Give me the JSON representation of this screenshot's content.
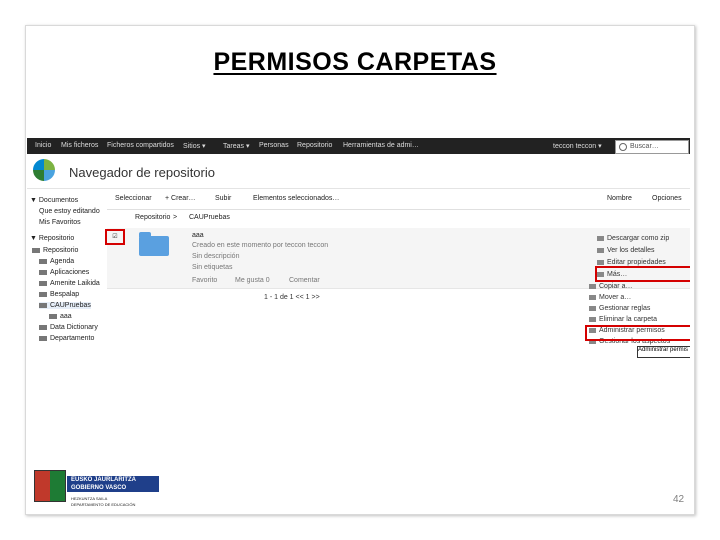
{
  "slide": {
    "title": "PERMISOS CARPETAS",
    "page_number": "42"
  },
  "topnav": {
    "items": [
      "Inicio",
      "Mis ficheros",
      "Ficheros compartidos",
      "Sitios ▾",
      "Tareas ▾",
      "Personas",
      "Repositorio",
      "Herramientas de admi…"
    ],
    "user": "teccon teccon ▾",
    "search_placeholder": "Buscar…"
  },
  "header": {
    "title": "Navegador de repositorio"
  },
  "sidebar": {
    "documents_header": "▼ Documentos",
    "doc_items": [
      "Que estoy editando",
      "Mis Favoritos"
    ],
    "repo_header": "▼ Repositorio",
    "repo_root": "Repositorio",
    "folders": [
      "Agenda",
      "Aplicaciones",
      "Amenite Laikida",
      "Bespalap",
      "CAUPruebas",
      "aaa",
      "Data Dictionary",
      "Departamento"
    ]
  },
  "toolbar": {
    "select": "Seleccionar",
    "create": "+ Crear…",
    "upload": "Subir",
    "selected": "Elementos seleccionados…",
    "name": "Nombre",
    "options": "Opciones"
  },
  "breadcrumb": {
    "root": "Repositorio",
    "sep": ">",
    "current": "CAUPruebas"
  },
  "folder_row": {
    "name": "aaa",
    "created": "Creado en este momento por teccon teccon",
    "no_description": "Sin descripción",
    "no_tags": "Sin etiquetas",
    "favorite": "Favorito",
    "like": "Me gusta  0",
    "comment": "Comentar"
  },
  "paging": "1 - 1 de 1   <<   1   >>",
  "actions": [
    "Descargar como zip",
    "Ver los detalles",
    "Editar propiedades",
    "Más…",
    "Copiar a…",
    "Mover a…",
    "Gestionar reglas",
    "Eliminar la carpeta",
    "Administrar permisos",
    "Gestionar los aspectos"
  ],
  "tooltip": "Administrar permis",
  "emblem": {
    "line1": "EUSKO JAURLARITZA",
    "line2": "GOBIERNO VASCO",
    "line3": "HEZKUNTZA SAILA",
    "line4": "DEPARTAMENTO DE EDUCACIÓN"
  },
  "colors": {
    "highlight": "#d40000",
    "navbar": "#222222",
    "folder": "#5aa0e0",
    "emblem_blue": "#1f3f8a"
  }
}
